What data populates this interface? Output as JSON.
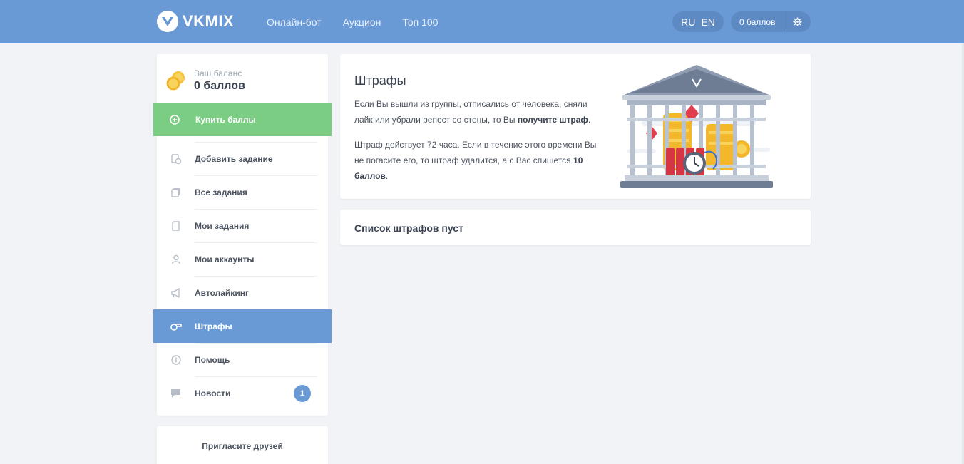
{
  "header": {
    "logo_text": "VKMIX",
    "nav": [
      "Онлайн-бот",
      "Аукцион",
      "Топ 100"
    ],
    "lang": [
      "RU",
      "EN"
    ],
    "balance": "0 баллов",
    "settings_icon": "gear-icon"
  },
  "sidebar": {
    "balance_label": "Ваш баланс",
    "balance_value": "0 баллов",
    "buy_label": "Купить баллы",
    "items": [
      {
        "label": "Добавить задание",
        "icon": "add-task-icon"
      },
      {
        "label": "Все задания",
        "icon": "all-tasks-icon"
      },
      {
        "label": "Мои задания",
        "icon": "my-tasks-icon"
      },
      {
        "label": "Мои аккаунты",
        "icon": "user-icon"
      },
      {
        "label": "Автолайкинг",
        "icon": "megaphone-icon"
      },
      {
        "label": "Штрафы",
        "icon": "whistle-icon",
        "active": true
      },
      {
        "label": "Помощь",
        "icon": "info-icon"
      },
      {
        "label": "Новости",
        "icon": "chat-icon",
        "badge": "1"
      }
    ],
    "invite_label": "Пригласите друзей"
  },
  "main": {
    "title": "Штрафы",
    "p1_text": "Если Вы вышли из группы, отписались от человека, сняли лайк или убрали репост со стены, то Вы ",
    "p1_bold": "получите штраф",
    "p1_end": ".",
    "p2_text": "Штраф действует 72 часа. Если в течение этого времени Вы не погасите его, то штраф удалится, а с Вас спишется ",
    "p2_bold": "10 баллов",
    "p2_end": ".",
    "empty_text": "Список штрафов пуст"
  },
  "colors": {
    "header": "#6a9ad6",
    "buy": "#7ccd84",
    "active": "#6a9ad6"
  }
}
